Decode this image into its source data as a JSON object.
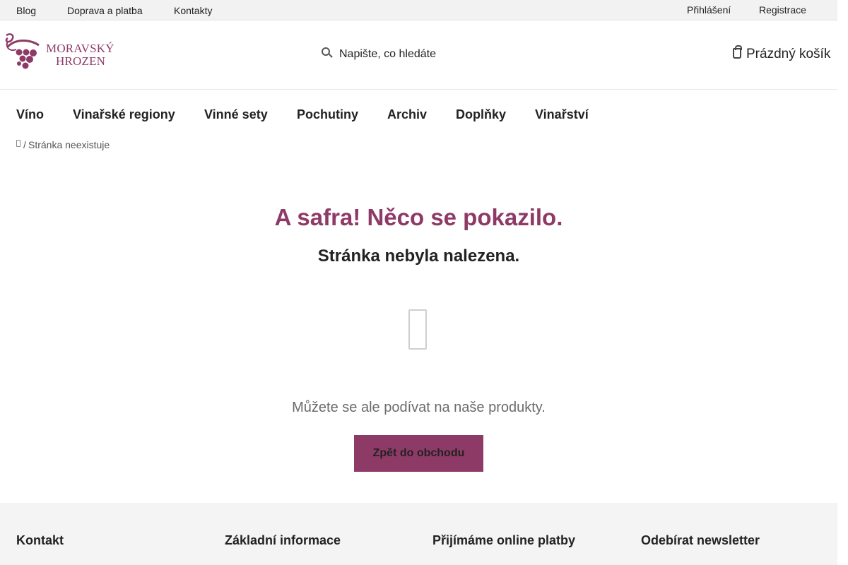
{
  "topbar": {
    "links": [
      "Blog",
      "Doprava a platba",
      "Kontakty"
    ],
    "login": "Přihlášení",
    "register": "Registrace"
  },
  "header": {
    "logo_line1": "MORAVSKÝ",
    "logo_line2": "HROZEN",
    "search_placeholder": "Napište, co hledáte",
    "cart_label": "Prázdný košík",
    "brand_color": "#8e3a67"
  },
  "nav": {
    "items": [
      "Víno",
      "Vinařské regiony",
      "Vinné sety",
      "Pochutiny",
      "Archiv",
      "Doplňky",
      "Vinařství"
    ]
  },
  "breadcrumb": {
    "separator": "/",
    "current": "Stránka neexistuje"
  },
  "main": {
    "title": "A safra! Něco se pokazilo.",
    "subtitle": "Stránka nebyla nalezena.",
    "text": "Můžete se ale podívat na naše produkty.",
    "button": "Zpět do obchodu"
  },
  "footer": {
    "columns": [
      "Kontakt",
      "Základní informace",
      "Přijímáme online platby",
      "Odebírat newsletter"
    ]
  },
  "icons": [
    "grape-logo-icon",
    "search-icon",
    "cart-icon",
    "home-icon",
    "document-icon"
  ]
}
